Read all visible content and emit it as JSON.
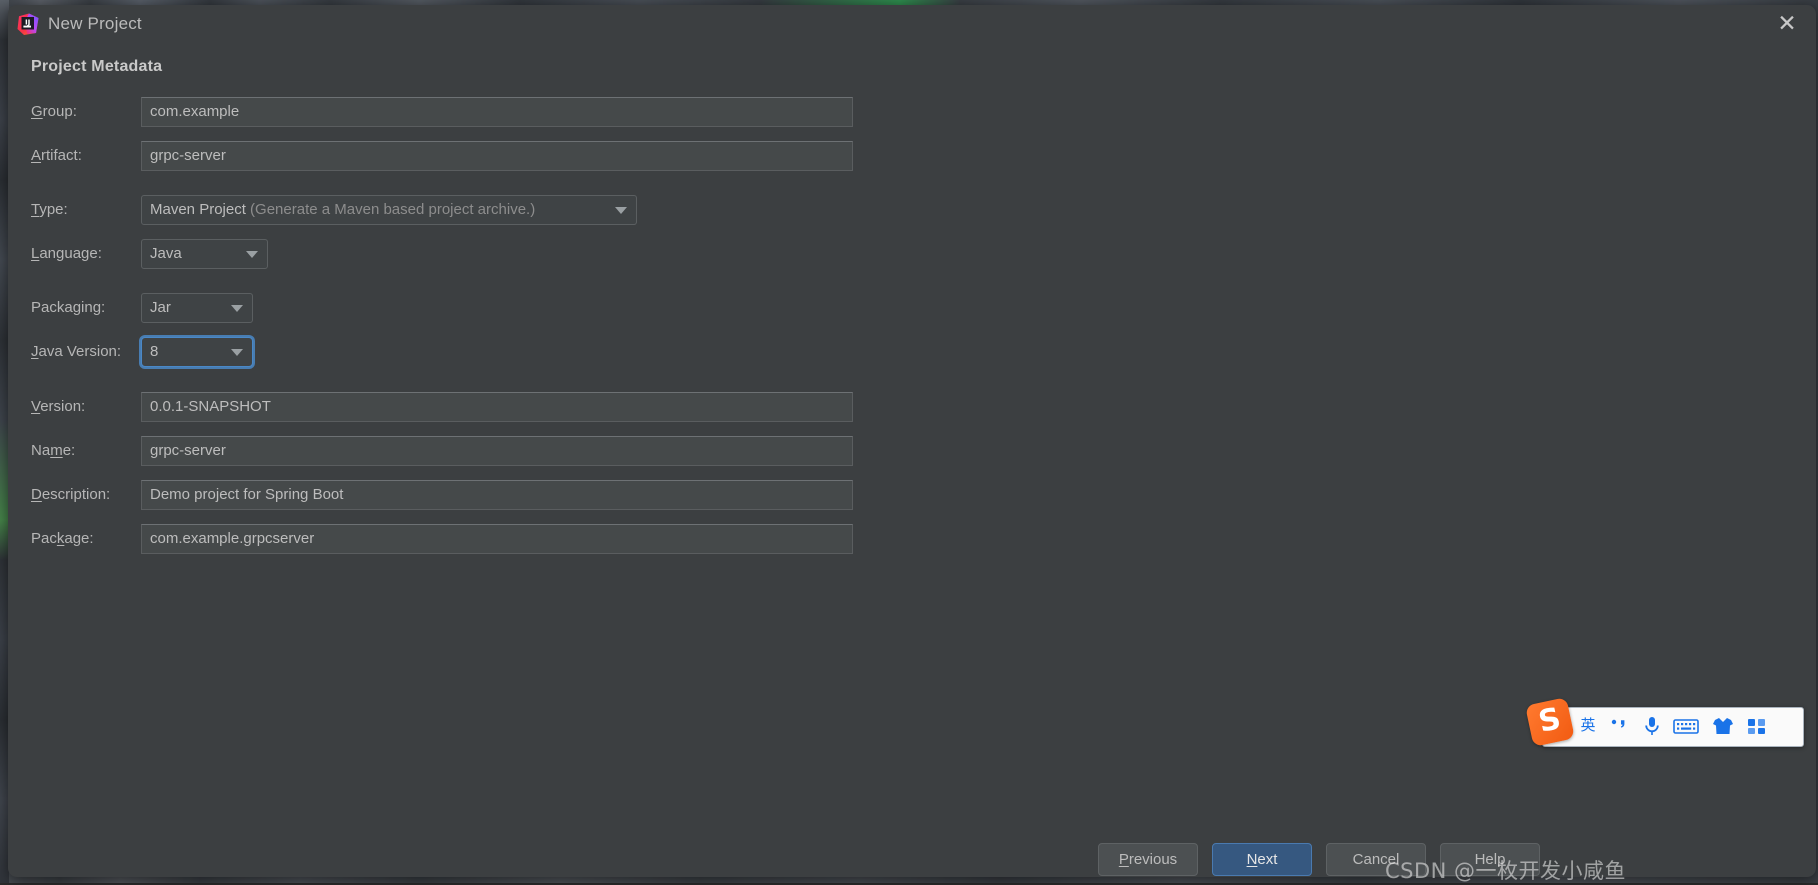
{
  "window": {
    "title": "New Project",
    "app_icon": "intellij-idea-icon",
    "close_icon": "close-icon"
  },
  "section": {
    "heading": "Project Metadata"
  },
  "form": {
    "fields": [
      {
        "label": "Group:",
        "mnemonic": "G",
        "value": "com.example",
        "kind": "text"
      },
      {
        "label": "Artifact:",
        "mnemonic": "A",
        "value": "grpc-server",
        "kind": "text"
      },
      {
        "label": "Type:",
        "mnemonic": "T",
        "value": "Maven Project",
        "hint": "(Generate a Maven based project archive.)",
        "kind": "combo"
      },
      {
        "label": "Language:",
        "mnemonic": "L",
        "value": "Java",
        "kind": "combo"
      },
      {
        "label": "Packaging:",
        "mnemonic": "",
        "value": "Jar",
        "kind": "combo"
      },
      {
        "label": "Java Version:",
        "mnemonic": "J",
        "value": "8",
        "kind": "combo",
        "focused": true
      },
      {
        "label": "Version:",
        "mnemonic": "V",
        "value": "0.0.1-SNAPSHOT",
        "kind": "text"
      },
      {
        "label": "Name:",
        "mnemonic": "m",
        "value": "grpc-server",
        "kind": "text"
      },
      {
        "label": "Description:",
        "mnemonic": "D",
        "value": "Demo project for Spring Boot",
        "kind": "text"
      },
      {
        "label": "Package:",
        "mnemonic": "k",
        "value": "com.example.grpcserver",
        "kind": "text"
      }
    ]
  },
  "buttons": {
    "previous": "Previous",
    "next": "Next",
    "cancel": "Cancel",
    "help": "Help"
  },
  "ime": {
    "mode_label": "英",
    "punctuation_label": "，",
    "items": [
      {
        "name": "ime-mode-chinese-english",
        "label": "英"
      },
      {
        "name": "ime-punctuation-toggle",
        "label": "，"
      },
      {
        "name": "ime-voice-input-icon",
        "label": ""
      },
      {
        "name": "ime-soft-keyboard-icon",
        "label": ""
      },
      {
        "name": "ime-skin-icon",
        "label": ""
      },
      {
        "name": "ime-toolbox-icon",
        "label": ""
      }
    ]
  },
  "watermark": {
    "text": "CSDN @一枚开发小咸鱼"
  },
  "colors": {
    "dialog_bg": "#3c3f41",
    "field_bg": "#45494a",
    "focus_ring": "#4a88c7",
    "default_button": "#365880",
    "ime_orange": "#f25b12",
    "ime_blue": "#1a73e8"
  }
}
